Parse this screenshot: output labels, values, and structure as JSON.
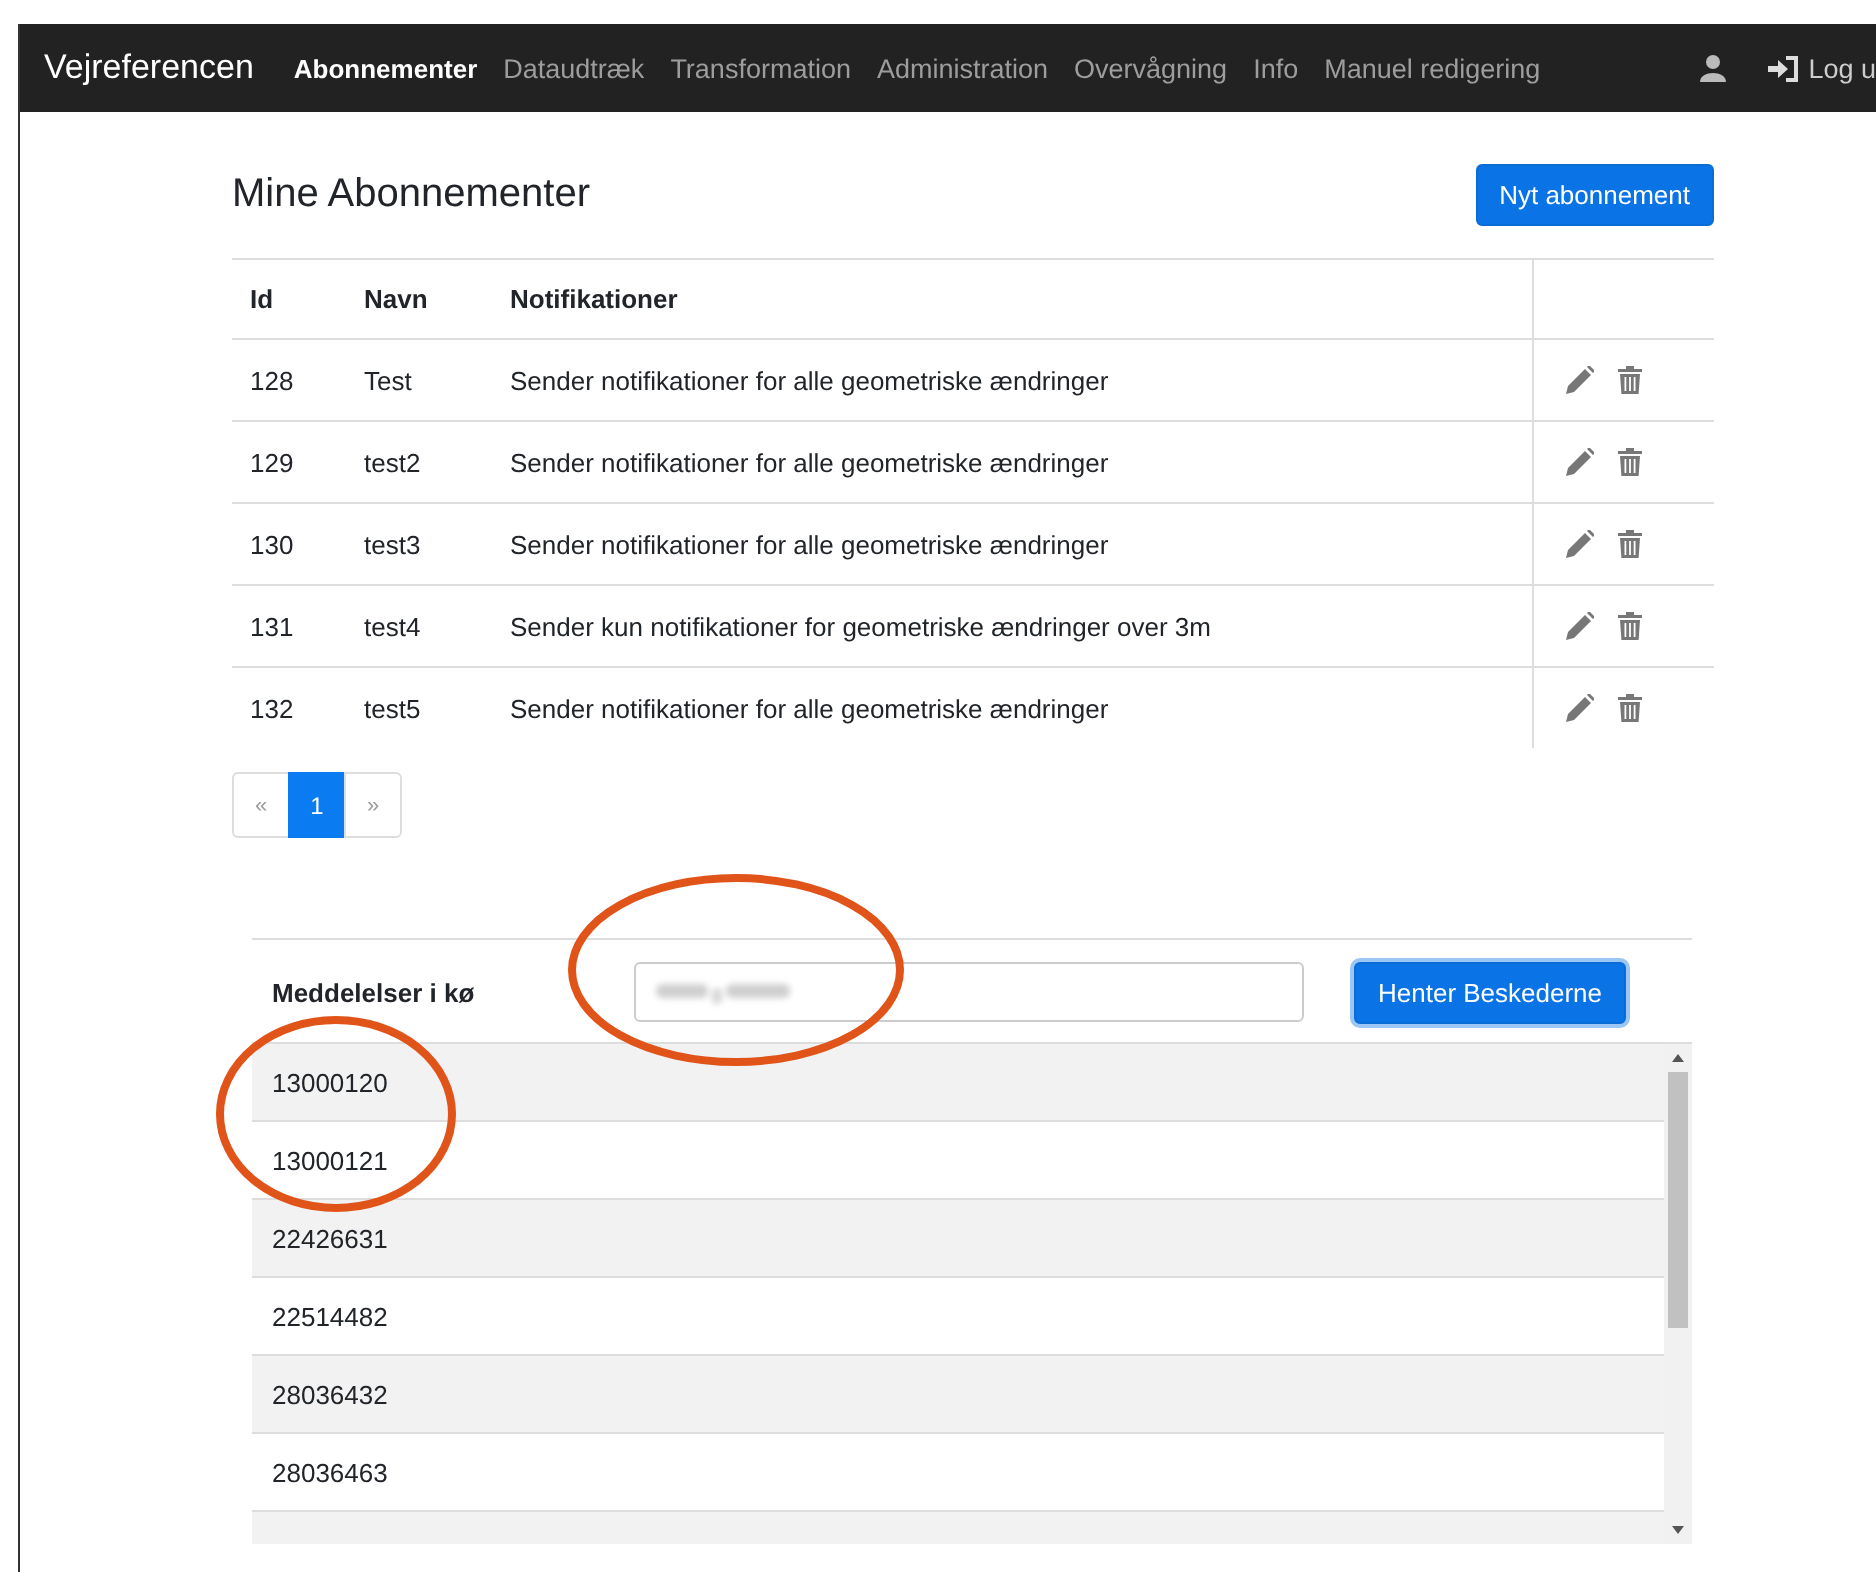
{
  "navbar": {
    "brand": "Vejreferencen",
    "items": [
      {
        "label": "Abonnementer",
        "selected": true
      },
      {
        "label": "Dataudtræk",
        "selected": false
      },
      {
        "label": "Transformation",
        "selected": false
      },
      {
        "label": "Administration",
        "selected": false
      },
      {
        "label": "Overvågning",
        "selected": false
      },
      {
        "label": "Info",
        "selected": false
      },
      {
        "label": "Manuel redigering",
        "selected": false
      }
    ],
    "logout": "Log u"
  },
  "title": "Mine Abonnementer",
  "new_button": "Nyt abonnement",
  "table": {
    "columns": [
      "Id",
      "Navn",
      "Notifikationer"
    ],
    "rows": [
      {
        "id": "128",
        "name": "Test",
        "notification": "Sender notifikationer for alle geometriske ændringer"
      },
      {
        "id": "129",
        "name": "test2",
        "notification": "Sender notifikationer for alle geometriske ændringer"
      },
      {
        "id": "130",
        "name": "test3",
        "notification": "Sender notifikationer for alle geometriske ændringer"
      },
      {
        "id": "131",
        "name": "test4",
        "notification": "Sender kun notifikationer for geometriske ændringer over 3m"
      },
      {
        "id": "132",
        "name": "test5",
        "notification": "Sender notifikationer for alle geometriske ændringer"
      }
    ]
  },
  "pagination": {
    "prev": "«",
    "pages": [
      {
        "label": "1",
        "selected": true
      }
    ],
    "next": "»"
  },
  "queue": {
    "label": "Meddelelser i kø",
    "button": "Henter Beskederne",
    "messages": [
      "13000120",
      "13000121",
      "22426631",
      "22514482",
      "28036432",
      "28036463"
    ]
  }
}
